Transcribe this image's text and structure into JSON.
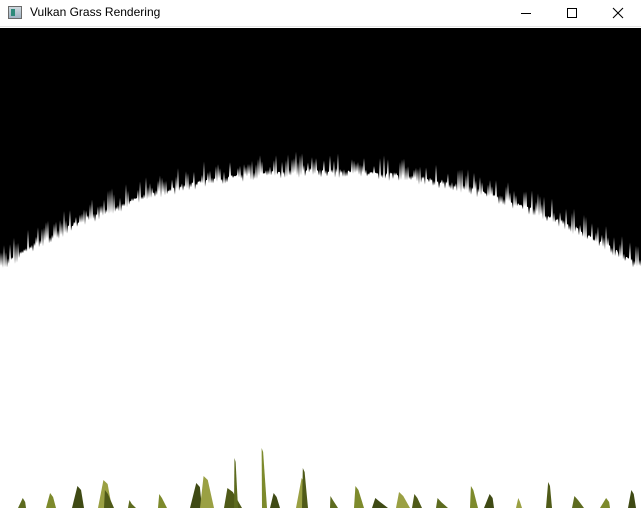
{
  "window": {
    "title": "Vulkan Grass Rendering",
    "app_icon": "vulkan-app-icon",
    "controls": {
      "minimize_icon": "minimize-icon",
      "maximize_icon": "maximize-icon",
      "close_icon": "close-icon"
    }
  },
  "scene": {
    "sky_color": "#000000",
    "ground_color": "#ffffff",
    "grass_colors": [
      "#5d6b1f",
      "#7d8a2c",
      "#3f4a14",
      "#9aa043",
      "#4f5a18"
    ]
  }
}
